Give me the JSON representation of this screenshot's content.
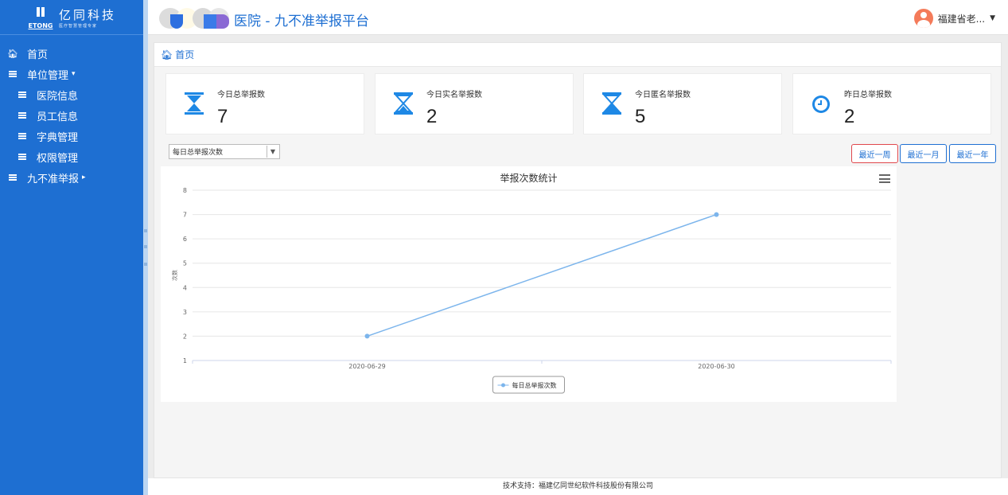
{
  "brand": {
    "logo_letters": "ETONG",
    "logo_cn": "亿同科技",
    "logo_tagline": "医疗智慧管理专家"
  },
  "header": {
    "title": "医院 - 九不准举报平台",
    "user_name": "福建省老..."
  },
  "sidebar": {
    "items": [
      {
        "label": "首页",
        "icon": "home-icon"
      },
      {
        "label": "单位管理",
        "icon": "list-icon",
        "caret": "▾"
      },
      {
        "label": "医院信息",
        "icon": "list-icon"
      },
      {
        "label": "员工信息",
        "icon": "list-icon"
      },
      {
        "label": "字典管理",
        "icon": "list-icon"
      },
      {
        "label": "权限管理",
        "icon": "list-icon"
      },
      {
        "label": "九不准举报",
        "icon": "list-icon",
        "caret": "▸"
      }
    ]
  },
  "breadcrumb": {
    "home": "首页"
  },
  "stats": [
    {
      "label": "今日总举报数",
      "value": "7",
      "icon": "hourglass-icon"
    },
    {
      "label": "今日实名举报数",
      "value": "2",
      "icon": "hourglass-half-icon"
    },
    {
      "label": "今日匿名举报数",
      "value": "5",
      "icon": "hourglass-end-icon"
    },
    {
      "label": "昨日总举报数",
      "value": "2",
      "icon": "clock-icon"
    }
  ],
  "controls": {
    "select_value": "每日总举报次数",
    "range_buttons": [
      "最近一周",
      "最近一月",
      "最近一年"
    ],
    "active_range": "最近一周"
  },
  "colors": {
    "primary": "#1e6fd2",
    "icon_blue": "#1e88e5",
    "line": "#7cb5ec",
    "active_border": "#e0474c"
  },
  "chart_data": {
    "type": "line",
    "title": "举报次数统计",
    "ylabel": "次数",
    "xlabel": "",
    "categories": [
      "2020-06-29",
      "2020-06-30"
    ],
    "series": [
      {
        "name": "每日总举报次数",
        "values": [
          2,
          7
        ]
      }
    ],
    "ylim": [
      1,
      8
    ],
    "yticks": [
      "1",
      "2",
      "3",
      "4",
      "5",
      "6",
      "7",
      "8"
    ],
    "grid": true,
    "legend": "bottom-center"
  },
  "footer": {
    "text": "技术支持：福建亿同世纪软件科技股份有限公司"
  }
}
